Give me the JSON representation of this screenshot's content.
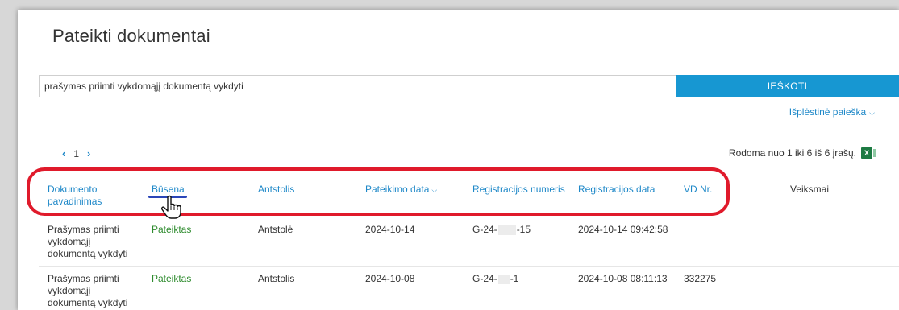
{
  "page": {
    "title": "Pateikti dokumentai"
  },
  "search": {
    "value": "prašymas priimti vykdomąjį dokumentą vykdyti",
    "button_label": "IEŠKOTI",
    "advanced_label": "Išplėstinė paieška"
  },
  "pager": {
    "prev": "‹",
    "page": "1",
    "next": "›"
  },
  "count_text": "Rodoma nuo 1 iki 6 iš 6 įrašų.",
  "table": {
    "headers": {
      "doc_name": "Dokumento pavadinimas",
      "status": "Būsena",
      "bailiff": "Antstolis",
      "submit_date": "Pateikimo data",
      "reg_number": "Registracijos numeris",
      "reg_date": "Registracijos data",
      "vd_nr": "VD Nr.",
      "actions": "Veiksmai"
    },
    "rows": [
      {
        "doc_name": "Prašymas priimti vykdomąjį dokumentą vykdyti",
        "status": "Pateiktas",
        "bailiff": "Antstolė",
        "submit_date": "2024-10-14",
        "reg_prefix": "G-24-",
        "reg_suffix": "-15",
        "reg_date": "2024-10-14 09:42:58",
        "vd_nr": ""
      },
      {
        "doc_name": "Prašymas priimti vykdomąjį dokumentą vykdyti",
        "status": "Pateiktas",
        "bailiff": "Antstolis",
        "submit_date": "2024-10-08",
        "reg_prefix": "G-24-",
        "reg_suffix": "-1",
        "reg_date": "2024-10-08 08:11:13",
        "vd_nr": "332275"
      }
    ]
  },
  "colors": {
    "accent": "#1797d2",
    "link": "#1e88c8",
    "status_green": "#2e8b2e",
    "highlight_red": "#e01a2b"
  },
  "icons": [
    "chevron-down-icon",
    "excel-icon",
    "hand-cursor-icon"
  ]
}
